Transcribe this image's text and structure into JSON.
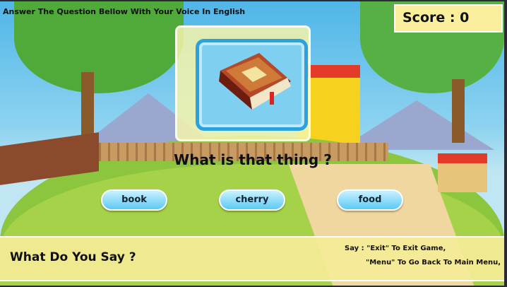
{
  "instruction": "Answer The Question Bellow With Your Voice In English",
  "score": {
    "label": "Score : 0"
  },
  "question": {
    "text": "What is that thing ?",
    "image": "book-icon"
  },
  "answers": [
    {
      "label": "book"
    },
    {
      "label": "cherry"
    },
    {
      "label": "food"
    }
  ],
  "bottom": {
    "prompt": "What Do You Say ?",
    "help_line1": "Say : \"Exit\" To Exit Game,",
    "help_line2": "\"Menu\" To Go Back To Main Menu,"
  }
}
